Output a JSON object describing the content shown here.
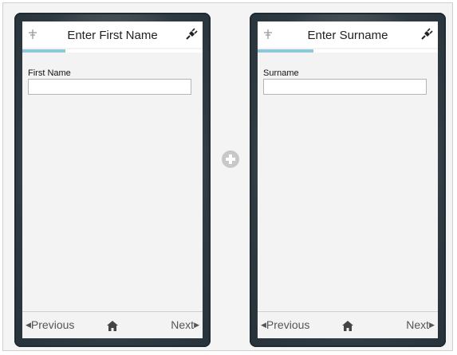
{
  "screens": [
    {
      "title": "Enter First Name",
      "left_icon": "pin-icon",
      "right_icon": "plug-icon",
      "progress_fraction": 0.24,
      "field_label": "First Name",
      "field_value": "",
      "nav": {
        "prev_label": "Previous",
        "next_label": "Next",
        "home_icon": "home-icon"
      }
    },
    {
      "title": "Enter Surname",
      "left_icon": "pin-icon",
      "right_icon": "plug-icon",
      "progress_fraction": 0.31,
      "field_label": "Surname",
      "field_value": "",
      "nav": {
        "prev_label": "Previous",
        "next_label": "Next",
        "home_icon": "home-icon"
      }
    }
  ],
  "add_screen_icon": "plus-circle-icon",
  "colors": {
    "accent_progress": "#8ec7db",
    "device_frame": "#2e3a41",
    "screen_bg": "#f3f3f3"
  }
}
